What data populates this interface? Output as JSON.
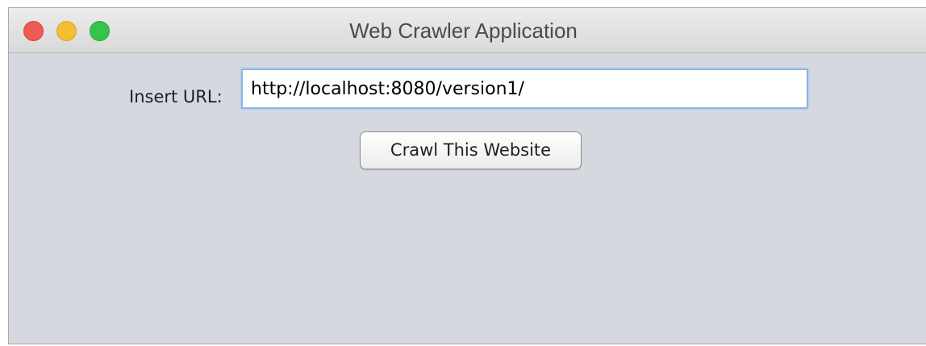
{
  "window": {
    "title": "Web Crawler Application"
  },
  "form": {
    "url_label": "Insert URL:",
    "url_value": "http://localhost:8080/version1/",
    "crawl_button_label": "Crawl This Website"
  },
  "colors": {
    "close": "#ee5b55",
    "minimize": "#f7bd32",
    "maximize": "#36c54a",
    "window_background": "#d6d8e0",
    "input_focus_ring": "#8fb4df"
  }
}
